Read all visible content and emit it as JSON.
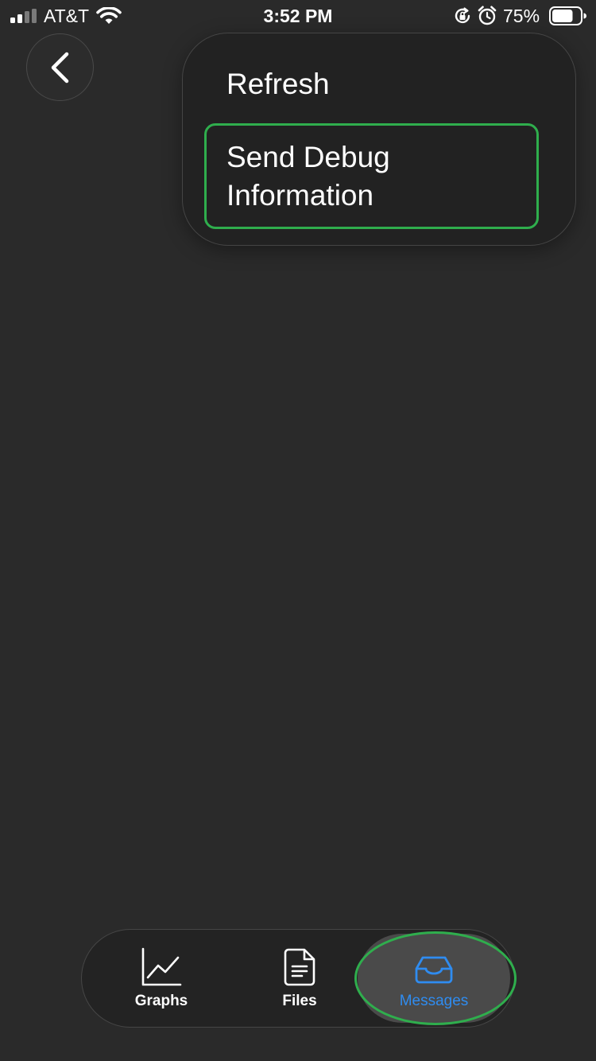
{
  "status_bar": {
    "carrier": "AT&T",
    "time": "3:52 PM",
    "battery_percent": "75%",
    "signal_bars_filled": 2,
    "signal_bars_total": 4,
    "battery_level": 0.75,
    "icons": [
      "signal-icon",
      "wifi-icon",
      "rotation-lock-icon",
      "alarm-icon",
      "battery-icon"
    ]
  },
  "header": {
    "back_icon": "chevron-left-icon"
  },
  "menu": {
    "items": [
      {
        "label": "Refresh"
      },
      {
        "label": "Send Debug Information",
        "highlighted": true
      }
    ]
  },
  "tab_bar": {
    "tabs": [
      {
        "label": "Graphs",
        "icon": "line-chart-icon",
        "selected": false
      },
      {
        "label": "Files",
        "icon": "document-icon",
        "selected": false
      },
      {
        "label": "Messages",
        "icon": "inbox-icon",
        "selected": true
      }
    ]
  },
  "colors": {
    "background": "#2a2a2a",
    "menu_background": "#222222",
    "highlight_outline": "#2fae4d",
    "accent": "#2f8cf0",
    "selected_tab_background": "#4a4a4a"
  }
}
